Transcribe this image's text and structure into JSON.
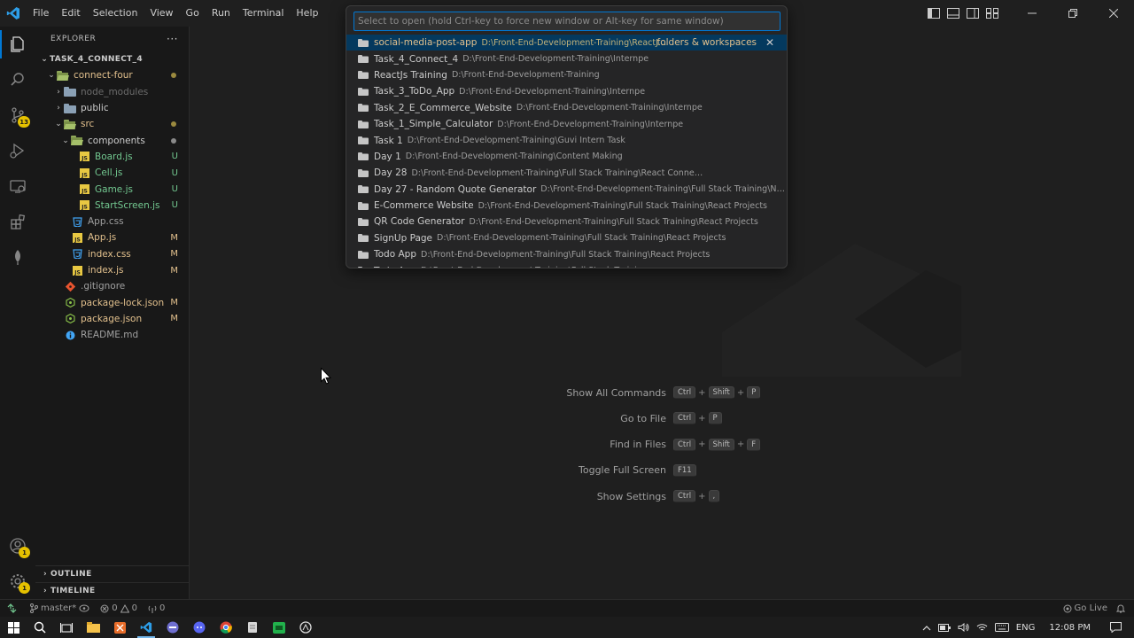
{
  "menu": [
    "File",
    "Edit",
    "Selection",
    "View",
    "Go",
    "Run",
    "Terminal",
    "Help"
  ],
  "sidebar": {
    "title": "EXPLORER",
    "more": "···",
    "workspace": "TASK_4_CONNECT_4",
    "tree": [
      {
        "label": "connect-four",
        "kind": "folder-open",
        "depth": 0,
        "color": "mod",
        "status": "dot"
      },
      {
        "label": "node_modules",
        "kind": "folder",
        "depth": 1,
        "color": "dim",
        "status": ""
      },
      {
        "label": "public",
        "kind": "folder",
        "depth": 1,
        "color": "plain",
        "status": ""
      },
      {
        "label": "src",
        "kind": "folder-open",
        "depth": 1,
        "color": "mod",
        "status": "dot"
      },
      {
        "label": "components",
        "kind": "folder-open",
        "depth": 2,
        "color": "plain",
        "status": "dot-grey"
      },
      {
        "label": "Board.js",
        "kind": "js",
        "depth": 3,
        "color": "new",
        "status": "U"
      },
      {
        "label": "Cell.js",
        "kind": "js",
        "depth": 3,
        "color": "new",
        "status": "U"
      },
      {
        "label": "Game.js",
        "kind": "js",
        "depth": 3,
        "color": "new",
        "status": "U"
      },
      {
        "label": "StartScreen.js",
        "kind": "js",
        "depth": 3,
        "color": "new",
        "status": "U"
      },
      {
        "label": "App.css",
        "kind": "css",
        "depth": 2,
        "color": "dim2",
        "status": ""
      },
      {
        "label": "App.js",
        "kind": "js",
        "depth": 2,
        "color": "mod",
        "status": "M"
      },
      {
        "label": "index.css",
        "kind": "css",
        "depth": 2,
        "color": "mod",
        "status": "M"
      },
      {
        "label": "index.js",
        "kind": "js",
        "depth": 2,
        "color": "mod",
        "status": "M"
      },
      {
        "label": ".gitignore",
        "kind": "git",
        "depth": 1,
        "color": "dim2",
        "status": ""
      },
      {
        "label": "package-lock.json",
        "kind": "json",
        "depth": 1,
        "color": "mod",
        "status": "M"
      },
      {
        "label": "package.json",
        "kind": "json",
        "depth": 1,
        "color": "mod",
        "status": "M"
      },
      {
        "label": "README.md",
        "kind": "info",
        "depth": 1,
        "color": "dim2",
        "status": ""
      }
    ],
    "sections": [
      "OUTLINE",
      "TIMELINE"
    ]
  },
  "badges": {
    "scm": "13",
    "accounts": "1",
    "settings": "1"
  },
  "quickopen": {
    "placeholder": "Select to open (hold Ctrl-key to force new window or Alt-key for same window)",
    "tag": "folders & workspaces",
    "close": "✕",
    "items": [
      {
        "name": "social-media-post-app",
        "path": "D:\\Front-End-Development-Training\\ReactJs Tr..."
      },
      {
        "name": "Task_4_Connect_4",
        "path": "D:\\Front-End-Development-Training\\Internpe"
      },
      {
        "name": "ReactJs Training",
        "path": "D:\\Front-End-Development-Training"
      },
      {
        "name": "Task_3_ToDo_App",
        "path": "D:\\Front-End-Development-Training\\Internpe"
      },
      {
        "name": "Task_2_E_Commerce_Website",
        "path": "D:\\Front-End-Development-Training\\Internpe"
      },
      {
        "name": "Task_1_Simple_Calculator",
        "path": "D:\\Front-End-Development-Training\\Internpe"
      },
      {
        "name": "Task 1",
        "path": "D:\\Front-End-Development-Training\\Guvi Intern Task"
      },
      {
        "name": "Day 1",
        "path": "D:\\Front-End-Development-Training\\Content Making"
      },
      {
        "name": "Day 28",
        "path": "D:\\Front-End-Development-Training\\Full Stack Training\\React Connect With Node"
      },
      {
        "name": "Day 27 - Random Quote Generator",
        "path": "D:\\Front-End-Development-Training\\Full Stack Training\\Node ..."
      },
      {
        "name": "E-Commerce Website",
        "path": "D:\\Front-End-Development-Training\\Full Stack Training\\React Projects"
      },
      {
        "name": "QR Code Generator",
        "path": "D:\\Front-End-Development-Training\\Full Stack Training\\React Projects"
      },
      {
        "name": "SignUp Page",
        "path": "D:\\Front-End-Development-Training\\Full Stack Training\\React Projects"
      },
      {
        "name": "Todo App",
        "path": "D:\\Front-End-Development-Training\\Full Stack Training\\React Projects"
      },
      {
        "name": "Todo App",
        "path": "D:\\Front-End-Development-Training\\Full Stack Training"
      }
    ]
  },
  "shortcuts": [
    {
      "label": "Show All Commands",
      "keys": [
        "Ctrl",
        "Shift",
        "P"
      ]
    },
    {
      "label": "Go to File",
      "keys": [
        "Ctrl",
        "P"
      ]
    },
    {
      "label": "Find in Files",
      "keys": [
        "Ctrl",
        "Shift",
        "F"
      ]
    },
    {
      "label": "Toggle Full Screen",
      "keys": [
        "F11"
      ]
    },
    {
      "label": "Show Settings",
      "keys": [
        "Ctrl",
        ","
      ]
    }
  ],
  "statusbar": {
    "branch": "master*",
    "errors": "0",
    "warnings": "0",
    "ports": "0",
    "golive": "Go Live"
  },
  "taskbar": {
    "lang": "ENG",
    "time": "12:08 PM"
  },
  "colors": {
    "accent": "#0078d4",
    "modified": "#e2c08d",
    "untracked": "#73c991",
    "badge": "#e5c100"
  }
}
